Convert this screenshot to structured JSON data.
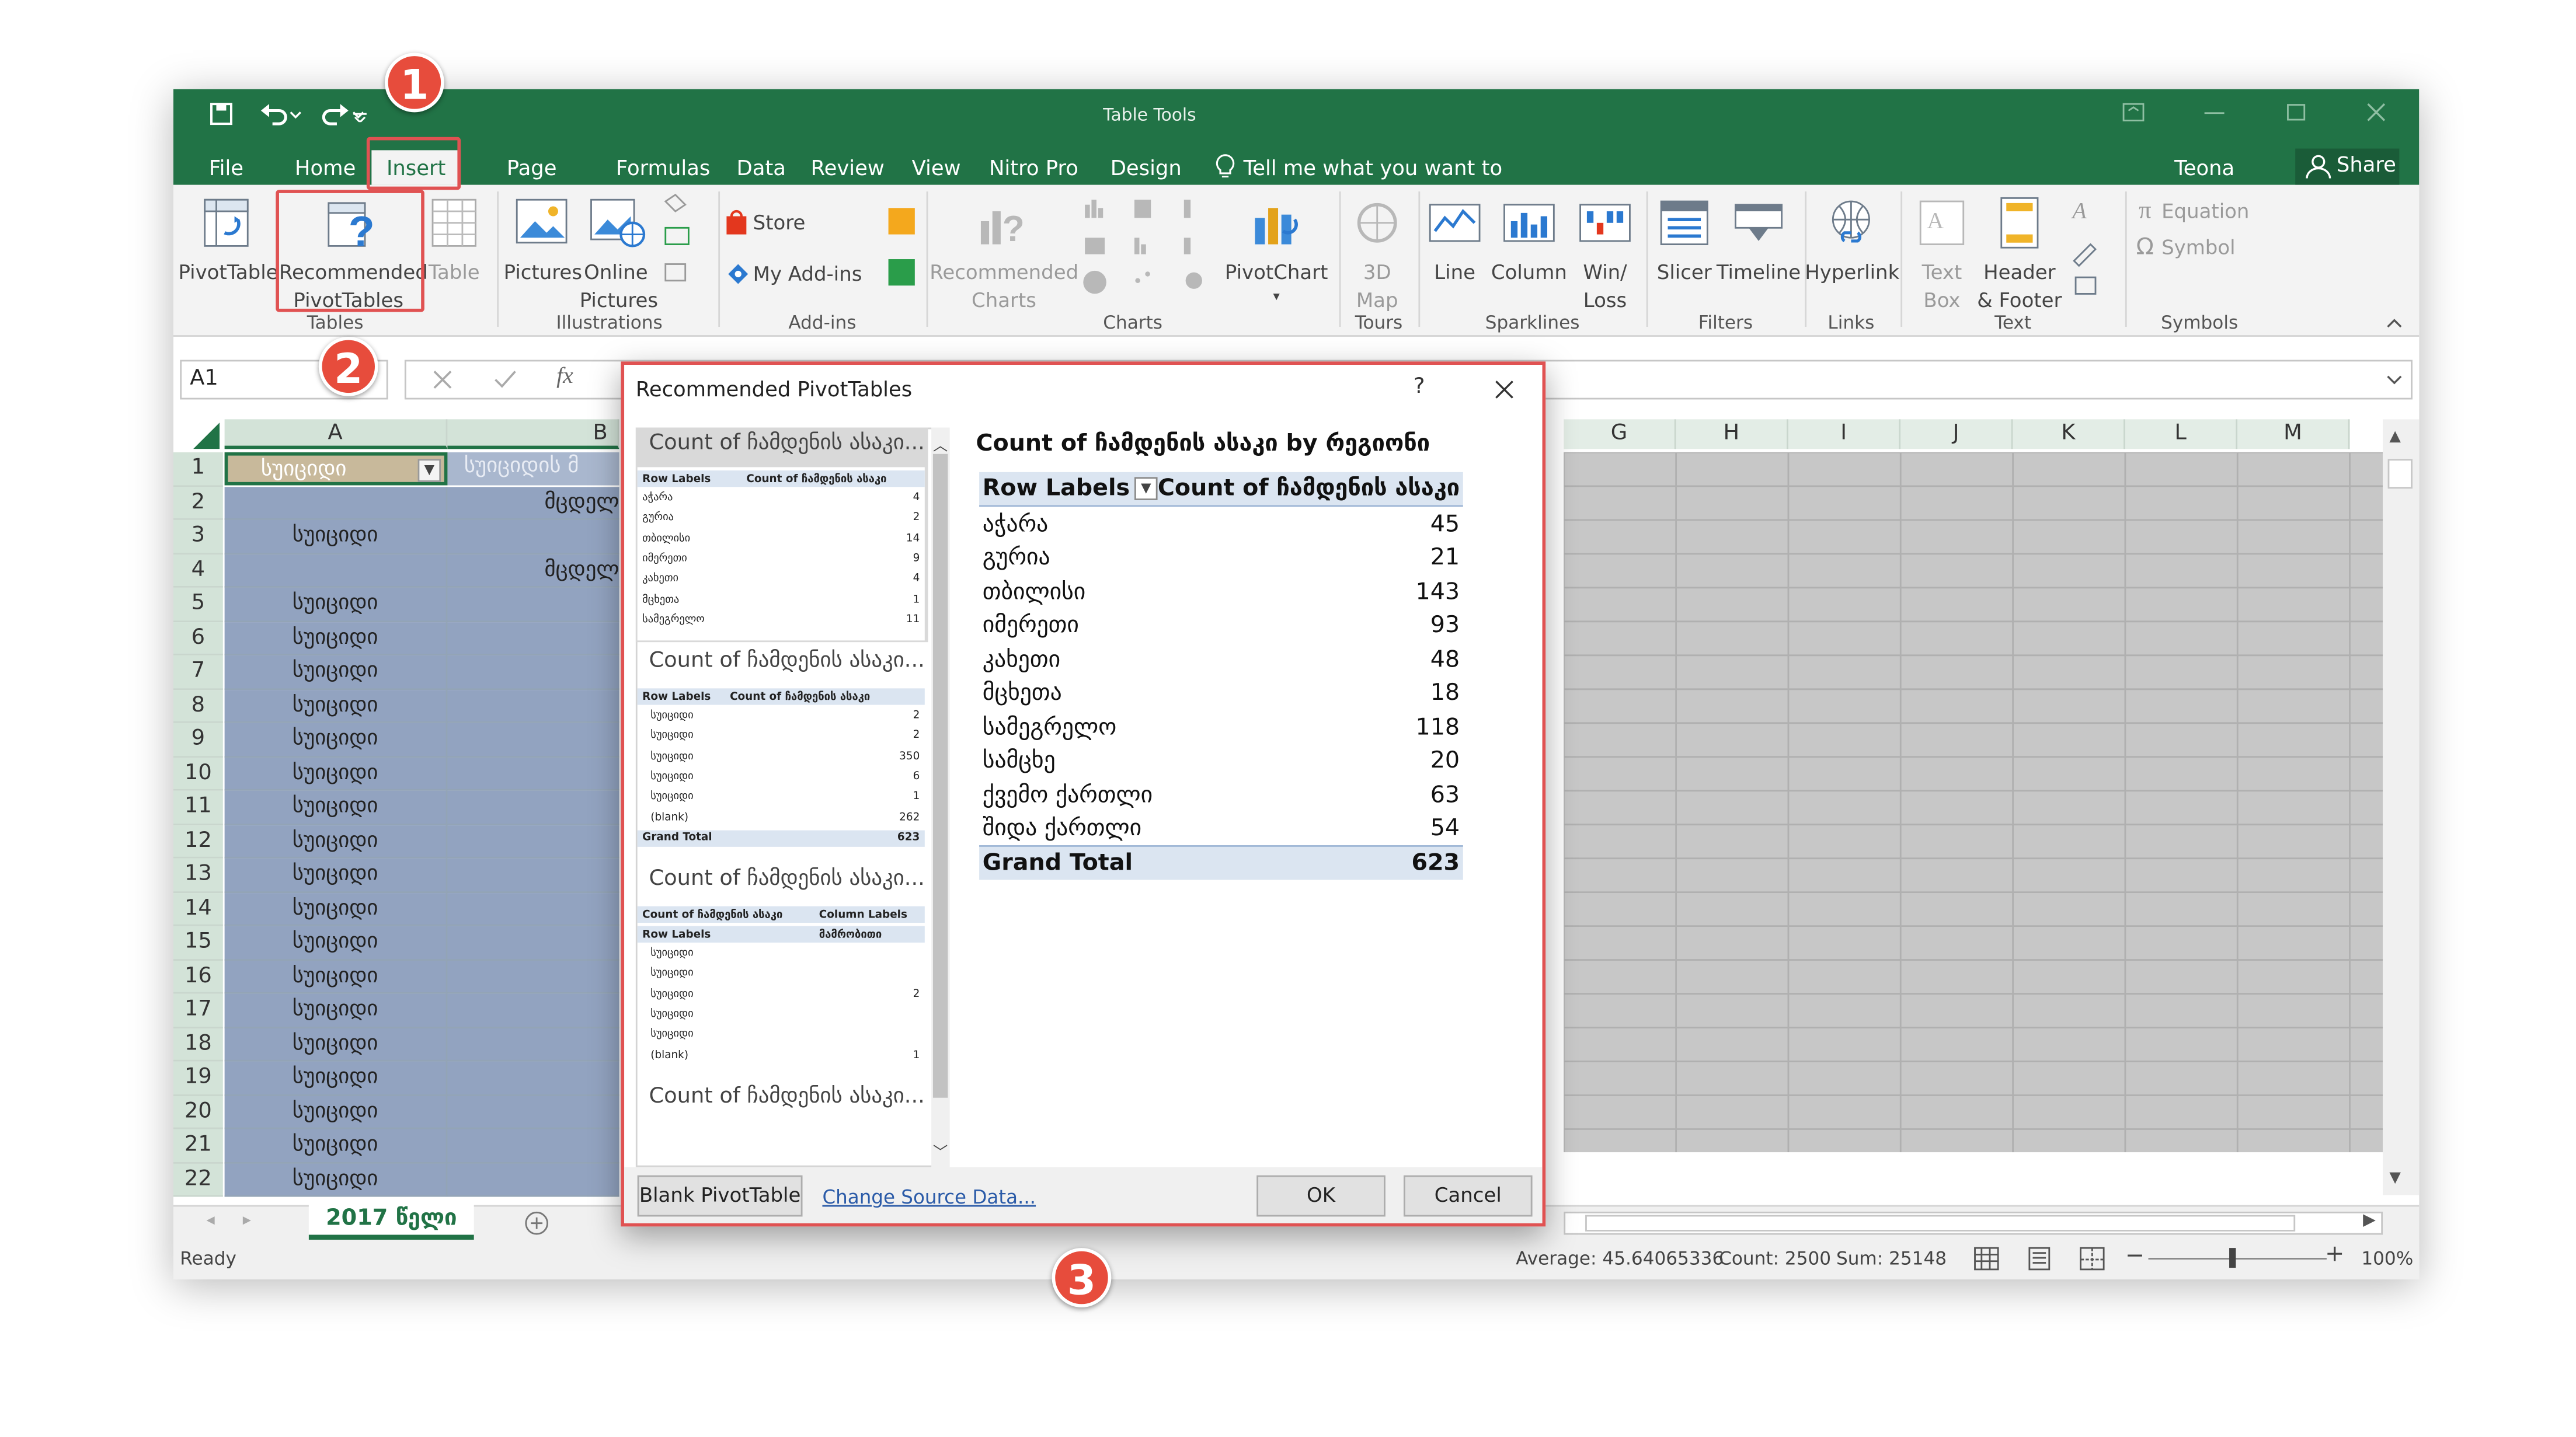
{
  "titlebar": {
    "table_tools": "Table Tools",
    "tabs": [
      "File",
      "Home",
      "Insert",
      "Page Layout",
      "Formulas",
      "Data",
      "Review",
      "View",
      "Nitro Pro",
      "Design"
    ],
    "tell_me": "Tell me what you want to do...",
    "user": "Teona Turashvili",
    "share": "Share"
  },
  "ribbon": {
    "pivottable": "PivotTable",
    "recommended_pivottables": [
      "Recommended",
      "PivotTables"
    ],
    "table": "Table",
    "pictures": "Pictures",
    "online_pictures": [
      "Online",
      "Pictures"
    ],
    "store": "Store",
    "my_addins": "My Add-ins",
    "recommended_charts": [
      "Recommended",
      "Charts"
    ],
    "pivotchart": "PivotChart",
    "map3d": [
      "3D",
      "Map"
    ],
    "line": "Line",
    "column": "Column",
    "winloss": [
      "Win/",
      "Loss"
    ],
    "slicer": "Slicer",
    "timeline": "Timeline",
    "hyperlink": "Hyperlink",
    "textbox": [
      "Text",
      "Box"
    ],
    "header_footer": [
      "Header",
      "& Footer"
    ],
    "equation": "Equation",
    "symbol": "Symbol",
    "groups": [
      "Tables",
      "Illustrations",
      "Add-ins",
      "Charts",
      "Tours",
      "Sparklines",
      "Filters",
      "Links",
      "Text",
      "Symbols"
    ]
  },
  "formula_bar": {
    "name_box": "A1"
  },
  "sheet": {
    "columns": [
      "A",
      "B",
      "G",
      "H",
      "I",
      "J",
      "K",
      "L",
      "M"
    ],
    "rows": [
      "1",
      "2",
      "3",
      "4",
      "5",
      "6",
      "7",
      "8",
      "9",
      "10",
      "11",
      "12",
      "13",
      "14",
      "15",
      "16",
      "17",
      "18",
      "19",
      "20",
      "21",
      "22"
    ],
    "header_a": "სუიციდი",
    "header_b": "სუიციდის მ",
    "col_a": [
      "",
      "სუიციდი",
      "",
      "სუიციდი",
      "სუიციდი",
      "სუიციდი",
      "სუიციდი",
      "სუიციდი",
      "სუიციდი",
      "სუიციდი",
      "სუიციდი",
      "სუიციდი",
      "სუიციდი",
      "სუიციდი",
      "სუიციდი",
      "სუიციდი",
      "სუიციდი",
      "სუიციდი",
      "სუიციდი",
      "სუიციდი",
      "სუიციდი"
    ],
    "col_b": [
      "მცდელ",
      "",
      "მცდელ",
      "",
      "",
      "",
      "",
      "",
      "",
      "",
      "",
      "",
      "",
      "",
      "",
      "",
      "",
      "",
      "",
      "",
      "",
      ""
    ],
    "tab_name": "2017 წელი"
  },
  "status": {
    "ready": "Ready",
    "average": "Average: 45.64065336",
    "count": "Count: 2500",
    "sum": "Sum: 25148",
    "zoom": "100%"
  },
  "dialog": {
    "title": "Recommended PivotTables",
    "help": "?",
    "thumb_titles": [
      "Count of ჩამდენის ასაკი...",
      "Count of ჩამდენის ასაკი...",
      "Count of ჩამდენის ასაკი...",
      "Count of ჩამდენის ასაკი..."
    ],
    "thumb1": {
      "headers": [
        "Row Labels",
        "Count of ჩამდენის ასაკი"
      ],
      "rows": [
        [
          "აჭარა",
          "4"
        ],
        [
          "გურია",
          "2"
        ],
        [
          "თბილისი",
          "14"
        ],
        [
          "იმერეთი",
          "9"
        ],
        [
          "კახეთი",
          "4"
        ],
        [
          "მცხეთა",
          "1"
        ],
        [
          "სამეგრელო",
          "11"
        ]
      ]
    },
    "thumb2": {
      "headers": [
        "Row Labels",
        "Count of ჩამდენის ასაკი"
      ],
      "rows": [
        [
          "სუიციდი",
          "2"
        ],
        [
          "სუიციდი",
          "2"
        ],
        [
          "სუიციდი",
          "350"
        ],
        [
          "სუიციდი",
          "6"
        ],
        [
          "სუიციდი",
          "1"
        ],
        [
          "(blank)",
          "262"
        ]
      ],
      "total": [
        "Grand Total",
        "623"
      ]
    },
    "thumb3": {
      "headers": [
        "Count of ჩამდენის ასაკი",
        "Column Labels"
      ],
      "row_labels": "Row Labels",
      "col_value": "მამრობითი",
      "rows": [
        [
          "სუიციდი",
          ""
        ],
        [
          "სუიციდი",
          ""
        ],
        [
          "სუიციდი",
          "2"
        ],
        [
          "სუიციდი",
          ""
        ],
        [
          "სუიციდი",
          ""
        ],
        [
          "(blank)",
          "1"
        ]
      ]
    },
    "preview_title": "Count of ჩამდენის ასაკი by რეგიონი",
    "preview_headers": [
      "Row Labels",
      "Count of ჩამდენის ასაკი"
    ],
    "preview_rows": [
      [
        "აჭარა",
        "45"
      ],
      [
        "გურია",
        "21"
      ],
      [
        "თბილისი",
        "143"
      ],
      [
        "იმერეთი",
        "93"
      ],
      [
        "კახეთი",
        "48"
      ],
      [
        "მცხეთა",
        "18"
      ],
      [
        "სამეგრელო",
        "118"
      ],
      [
        "სამცხე",
        "20"
      ],
      [
        "ქვემო ქართლი",
        "63"
      ],
      [
        "შიდა ქართლი",
        "54"
      ]
    ],
    "grand_total": [
      "Grand Total",
      "623"
    ],
    "blank_pivot": "Blank PivotTable",
    "change_source": "Change Source Data...",
    "ok": "OK",
    "cancel": "Cancel"
  },
  "badges": [
    "1",
    "2",
    "3"
  ],
  "colors": {
    "excel_green": "#217346",
    "highlight_red": "#e05252",
    "selection_blue": "#92a3c0",
    "badge_red": "#e74c3c"
  }
}
